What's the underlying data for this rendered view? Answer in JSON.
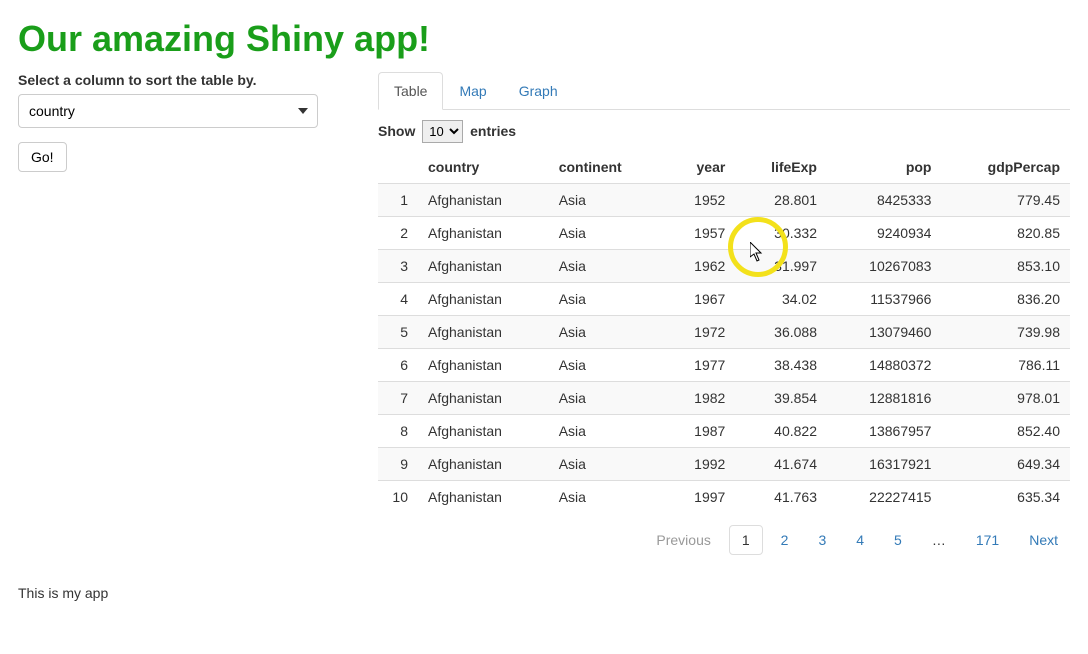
{
  "header": {
    "title": "Our amazing Shiny app!"
  },
  "sidebar": {
    "label": "Select a column to sort the table by.",
    "selectValue": "country",
    "goLabel": "Go!"
  },
  "tabs": [
    {
      "label": "Table",
      "active": true
    },
    {
      "label": "Map",
      "active": false
    },
    {
      "label": "Graph",
      "active": false
    }
  ],
  "lengthMenu": {
    "prefix": "Show",
    "value": "10",
    "suffix": "entries"
  },
  "table": {
    "columns": [
      "",
      "country",
      "continent",
      "year",
      "lifeExp",
      "pop",
      "gdpPercap"
    ],
    "rows": [
      [
        "1",
        "Afghanistan",
        "Asia",
        "1952",
        "28.801",
        "8425333",
        "779.45"
      ],
      [
        "2",
        "Afghanistan",
        "Asia",
        "1957",
        "30.332",
        "9240934",
        "820.85"
      ],
      [
        "3",
        "Afghanistan",
        "Asia",
        "1962",
        "31.997",
        "10267083",
        "853.10"
      ],
      [
        "4",
        "Afghanistan",
        "Asia",
        "1967",
        "34.02",
        "11537966",
        "836.20"
      ],
      [
        "5",
        "Afghanistan",
        "Asia",
        "1972",
        "36.088",
        "13079460",
        "739.98"
      ],
      [
        "6",
        "Afghanistan",
        "Asia",
        "1977",
        "38.438",
        "14880372",
        "786.11"
      ],
      [
        "7",
        "Afghanistan",
        "Asia",
        "1982",
        "39.854",
        "12881816",
        "978.01"
      ],
      [
        "8",
        "Afghanistan",
        "Asia",
        "1987",
        "40.822",
        "13867957",
        "852.40"
      ],
      [
        "9",
        "Afghanistan",
        "Asia",
        "1992",
        "41.674",
        "16317921",
        "649.34"
      ],
      [
        "10",
        "Afghanistan",
        "Asia",
        "1997",
        "41.763",
        "22227415",
        "635.34"
      ]
    ]
  },
  "paginate": {
    "previous": "Previous",
    "next": "Next",
    "pages": [
      "1",
      "2",
      "3",
      "4",
      "5",
      "…",
      "171"
    ],
    "activeIndex": 0
  },
  "footer": {
    "text": "This is my app"
  }
}
